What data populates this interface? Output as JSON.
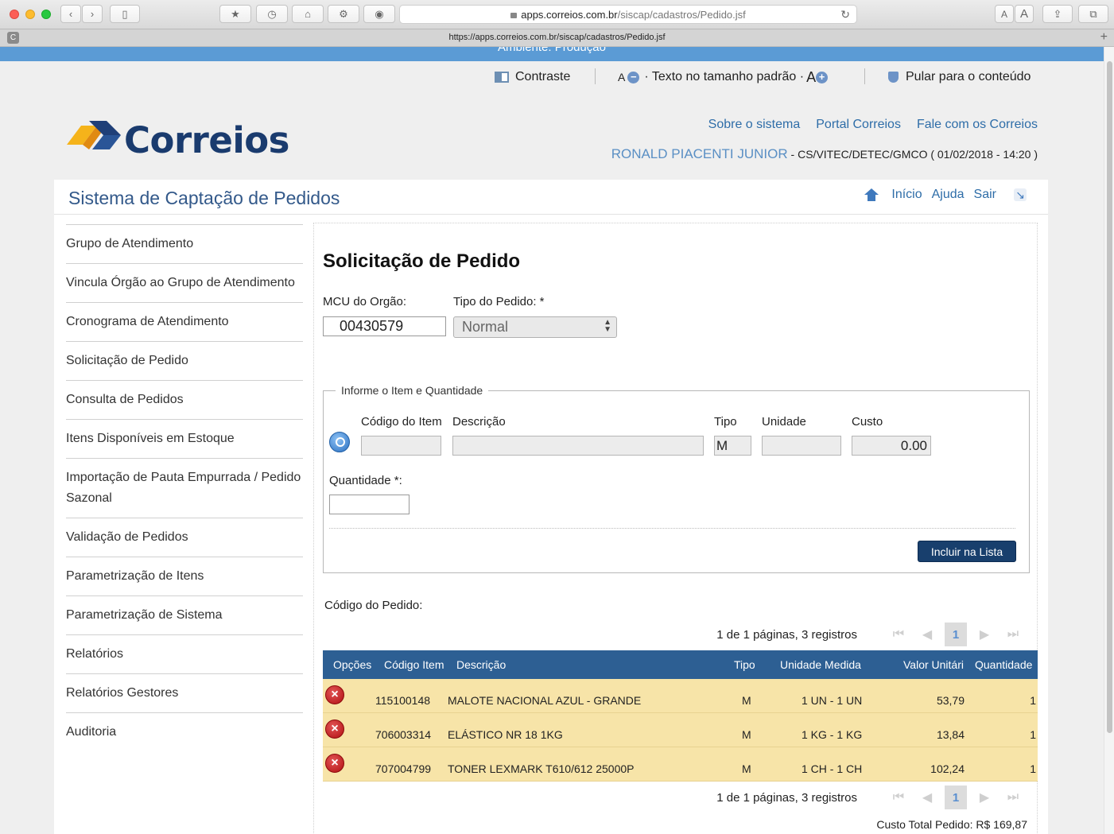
{
  "browser": {
    "url_host": "apps.correios.com.br",
    "url_path": "/siscap/cadastros/Pedido.jsf",
    "tab_title": "https://apps.correios.com.br/siscap/cadastros/Pedido.jsf",
    "favicon_letter": "C",
    "font_small": "A",
    "font_large": "A"
  },
  "env": {
    "text": "Ambiente: Produção"
  },
  "accessibility": {
    "contrast": "Contraste",
    "font_decrease": "A",
    "font_default": "· Texto no tamanho padrão ·",
    "font_increase": "A",
    "skip": "Pular para o conteúdo"
  },
  "logo_text": "Correios",
  "top_links": [
    "Sobre o sistema",
    "Portal Correios",
    "Fale com os Correios"
  ],
  "user": {
    "name": "RONALD PIACENTI JUNIOR",
    "info": " - CS/VITEC/DETEC/GMCO ( 01/02/2018 - 14:20 )"
  },
  "system_title": "Sistema de Captação de Pedidos",
  "panel_links": {
    "home": "Início",
    "help": "Ajuda",
    "exit": "Sair"
  },
  "menu": [
    "Grupo de Atendimento",
    "Vincula Órgão ao Grupo de Atendimento",
    "Cronograma de Atendimento",
    "Solicitação de Pedido",
    "Consulta de Pedidos",
    "Itens Disponíveis em Estoque",
    "Importação de Pauta Empurrada / Pedido Sazonal",
    "Validação de Pedidos",
    "Parametrização de Itens",
    "Parametrização de Sistema",
    "Relatórios",
    "Relatórios Gestores",
    "Auditoria"
  ],
  "form": {
    "title": "Solicitação de Pedido",
    "mcu_label": "MCU do Orgão:",
    "mcu_value": "00430579",
    "tipo_label": "Tipo do Pedido: *",
    "tipo_value": "Normal",
    "fieldset_legend": "Informe o Item e Quantidade",
    "col_codigo": "Código do Item",
    "col_descricao": "Descrição",
    "col_tipo": "Tipo",
    "col_unidade": "Unidade",
    "col_custo": "Custo",
    "tipo_field_value": "M",
    "custo_value": "0.00",
    "quantidade_label": "Quantidade *:",
    "include_button": "Incluir na Lista",
    "codigo_pedido_label": "Código do Pedido:"
  },
  "pager": {
    "info": "1 de 1 páginas, 3 registros",
    "page": "1"
  },
  "table": {
    "headers": [
      "Opções",
      "Código Item",
      "Descrição",
      "Tipo",
      "Unidade Medida",
      "Valor Unitári",
      "Quantidade"
    ],
    "rows": [
      {
        "codigo": "115100148",
        "descricao": "MALOTE NACIONAL AZUL - GRANDE",
        "tipo": "M",
        "unidade": "1 UN - 1 UN",
        "valor": "53,79",
        "quantidade": "1"
      },
      {
        "codigo": "706003314",
        "descricao": "ELÁSTICO NR 18 1KG",
        "tipo": "M",
        "unidade": "1 KG - 1 KG",
        "valor": "13,84",
        "quantidade": "1"
      },
      {
        "codigo": "707004799",
        "descricao": "TONER LEXMARK T610/612 25000P",
        "tipo": "M",
        "unidade": "1 CH - 1 CH",
        "valor": "102,24",
        "quantidade": "1"
      }
    ]
  },
  "total": "Custo Total Pedido: R$ 169,87",
  "colors": {
    "header_blue": "#2d5f93",
    "row_yellow": "#f7e4a8",
    "link_blue": "#2e6da8",
    "button_navy": "#183f6d"
  }
}
